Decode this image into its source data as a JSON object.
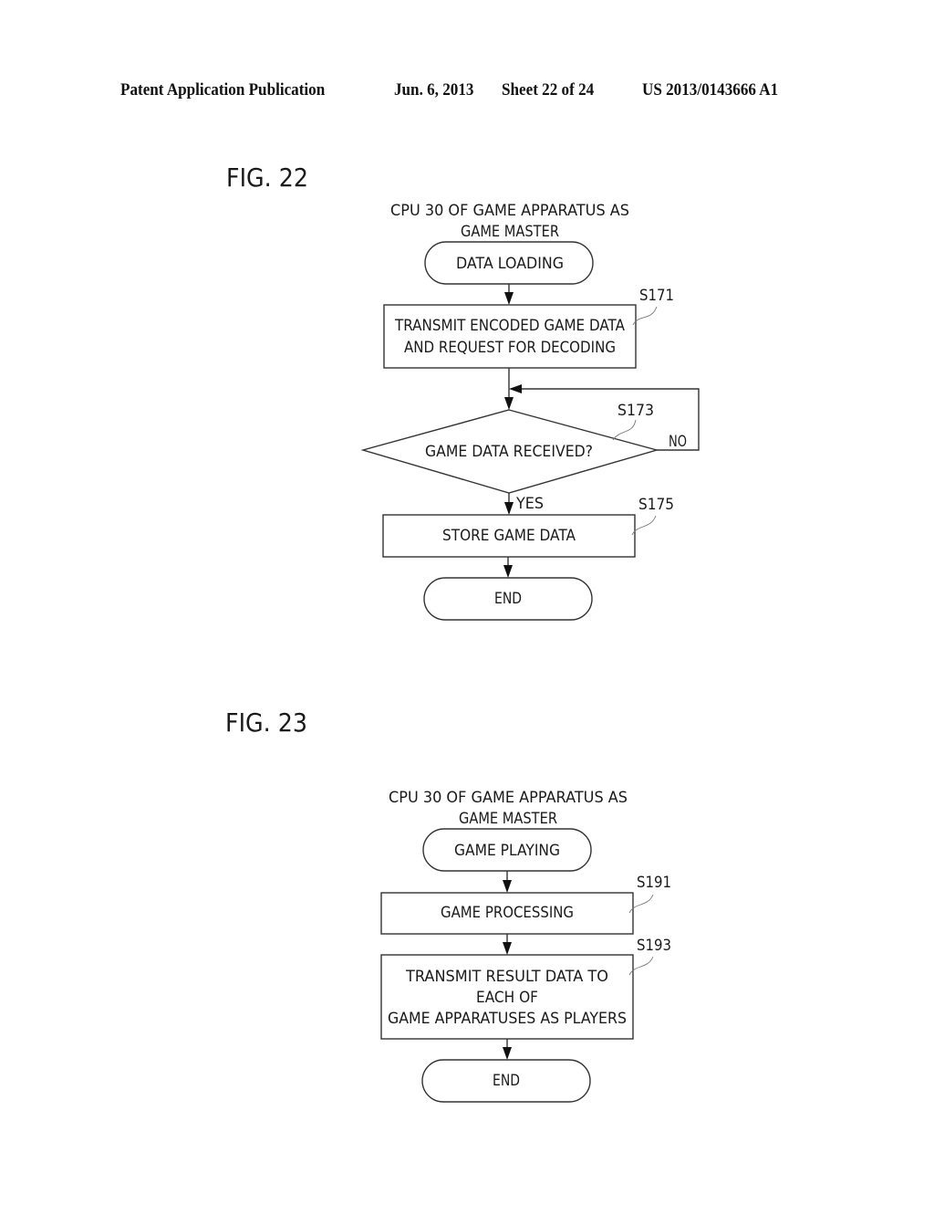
{
  "header": {
    "publication": "Patent Application Publication",
    "date": "Jun. 6, 2013",
    "sheet": "Sheet 22 of 24",
    "number": "US 2013/0143666 A1"
  },
  "fig22": {
    "title": "FIG. 22",
    "actor_line1": "CPU 30 OF GAME APPARATUS AS",
    "actor_line2": "GAME MASTER",
    "start": "DATA LOADING",
    "s171": {
      "label": "S171",
      "line1": "TRANSMIT ENCODED GAME DATA",
      "line2": "AND REQUEST FOR DECODING"
    },
    "s173": {
      "label": "S173",
      "text": "GAME DATA RECEIVED?",
      "yes": "YES",
      "no": "NO"
    },
    "s175": {
      "label": "S175",
      "text": "STORE GAME DATA"
    },
    "end": "END"
  },
  "fig23": {
    "title": "FIG. 23",
    "actor_line1": "CPU 30 OF GAME APPARATUS AS",
    "actor_line2": "GAME MASTER",
    "start": "GAME PLAYING",
    "s191": {
      "label": "S191",
      "text": "GAME PROCESSING"
    },
    "s193": {
      "label": "S193",
      "line1": "TRANSMIT RESULT DATA TO",
      "line2": "EACH OF",
      "line3": "GAME APPARATUSES AS PLAYERS"
    },
    "end": "END"
  }
}
